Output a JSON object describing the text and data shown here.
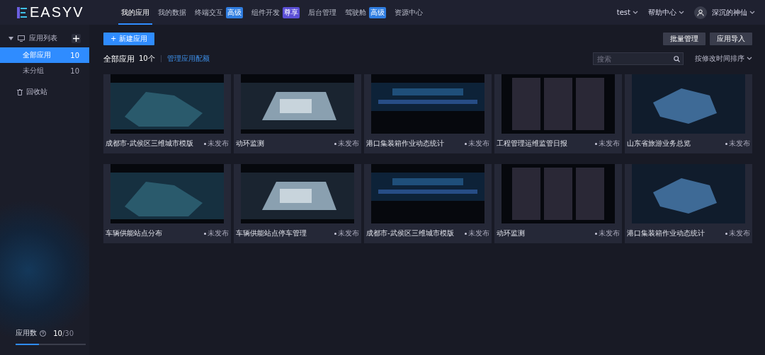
{
  "header": {
    "logo": "EASYV",
    "nav": [
      {
        "label": "我的应用",
        "selected": true
      },
      {
        "label": "我的数据",
        "selected": false
      },
      {
        "label": "终端交互",
        "selected": false,
        "badge": "高级",
        "color": "#2f7de1"
      },
      {
        "label": "组件开发",
        "selected": false,
        "badge": "尊享",
        "color": "#5b4fd6"
      },
      {
        "label": "后台管理",
        "selected": false
      },
      {
        "label": "驾驶舱",
        "selected": false,
        "badge": "高级",
        "color": "#2f7de1"
      },
      {
        "label": "资源中心",
        "selected": false
      }
    ],
    "workspace": "test",
    "help": "帮助中心",
    "user": "深沉的神仙"
  },
  "sidebar": {
    "title": "应用列表",
    "expanded": true,
    "groups": [
      {
        "label": "全部应用",
        "count": "10",
        "selected": true
      },
      {
        "label": "未分组",
        "count": "10",
        "selected": false
      }
    ],
    "trash": "回收站",
    "usage": {
      "label": "应用数",
      "used": "10",
      "total": "/30",
      "level": 0.33
    }
  },
  "toolbar": {
    "new_button": "+ 新建应用",
    "batch_button": "批量管理",
    "import_button": "应用导入",
    "heading": "全部应用",
    "count": "10个",
    "quota_link": "管理应用配额",
    "search": {
      "placeholder": "搜索"
    },
    "sort": "按修改时间排序"
  },
  "apps": [
    {
      "name": "成都市-武侯区三维城市模版",
      "status": "未发布"
    },
    {
      "name": "动环监测",
      "status": "未发布"
    },
    {
      "name": "港口集装箱作业动态统计",
      "status": "未发布"
    },
    {
      "name": "工程管理运维监管日报",
      "status": "未发布"
    },
    {
      "name": "山东省旅游业务总览",
      "status": "未发布"
    },
    {
      "name": "车辆供能站点分布",
      "status": "未发布"
    },
    {
      "name": "车辆供能站点停车管理",
      "status": "未发布"
    },
    {
      "name": "成都市-武侯区三维城市模版",
      "status": "未发布"
    },
    {
      "name": "动环监测",
      "status": "未发布"
    },
    {
      "name": "港口集装箱作业动态统计",
      "status": "未发布"
    }
  ]
}
